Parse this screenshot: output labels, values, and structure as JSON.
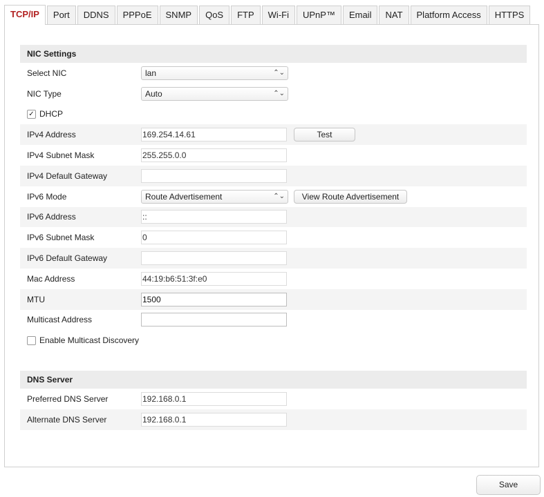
{
  "tabs": [
    "TCP/IP",
    "Port",
    "DDNS",
    "PPPoE",
    "SNMP",
    "QoS",
    "FTP",
    "Wi-Fi",
    "UPnP™",
    "Email",
    "NAT",
    "Platform Access",
    "HTTPS"
  ],
  "nic": {
    "title": "NIC Settings",
    "select_nic": {
      "label": "Select NIC",
      "value": "lan"
    },
    "nic_type": {
      "label": "NIC Type",
      "value": "Auto"
    },
    "dhcp": {
      "label": "DHCP",
      "checked": true
    },
    "ipv4_address": {
      "label": "IPv4 Address",
      "value": "169.254.14.61"
    },
    "test_button": "Test",
    "ipv4_subnet": {
      "label": "IPv4 Subnet Mask",
      "value": "255.255.0.0"
    },
    "ipv4_gateway": {
      "label": "IPv4 Default Gateway",
      "value": ""
    },
    "ipv6_mode": {
      "label": "IPv6 Mode",
      "value": "Route Advertisement"
    },
    "view_route_button": "View Route Advertisement",
    "ipv6_address": {
      "label": "IPv6 Address",
      "value": "::"
    },
    "ipv6_subnet": {
      "label": "IPv6 Subnet Mask",
      "value": "0"
    },
    "ipv6_gateway": {
      "label": "IPv6 Default Gateway",
      "value": ""
    },
    "mac_address": {
      "label": "Mac Address",
      "value": "44:19:b6:51:3f:e0"
    },
    "mtu": {
      "label": "MTU",
      "value": "1500"
    },
    "multicast": {
      "label": "Multicast Address",
      "value": ""
    },
    "multicast_discovery": {
      "label": "Enable Multicast Discovery",
      "checked": false
    }
  },
  "dns": {
    "title": "DNS Server",
    "preferred": {
      "label": "Preferred DNS Server",
      "value": "192.168.0.1"
    },
    "alternate": {
      "label": "Alternate DNS Server",
      "value": "192.168.0.1"
    }
  },
  "save_label": "Save",
  "icons": {
    "select_chevron": "up-down-chevron-icon",
    "checkbox_check": "checkmark-icon"
  },
  "colors": {
    "active_tab_text": "#b22222",
    "section_header_bg": "#ececec",
    "row_shade": "#f4f4f4"
  }
}
